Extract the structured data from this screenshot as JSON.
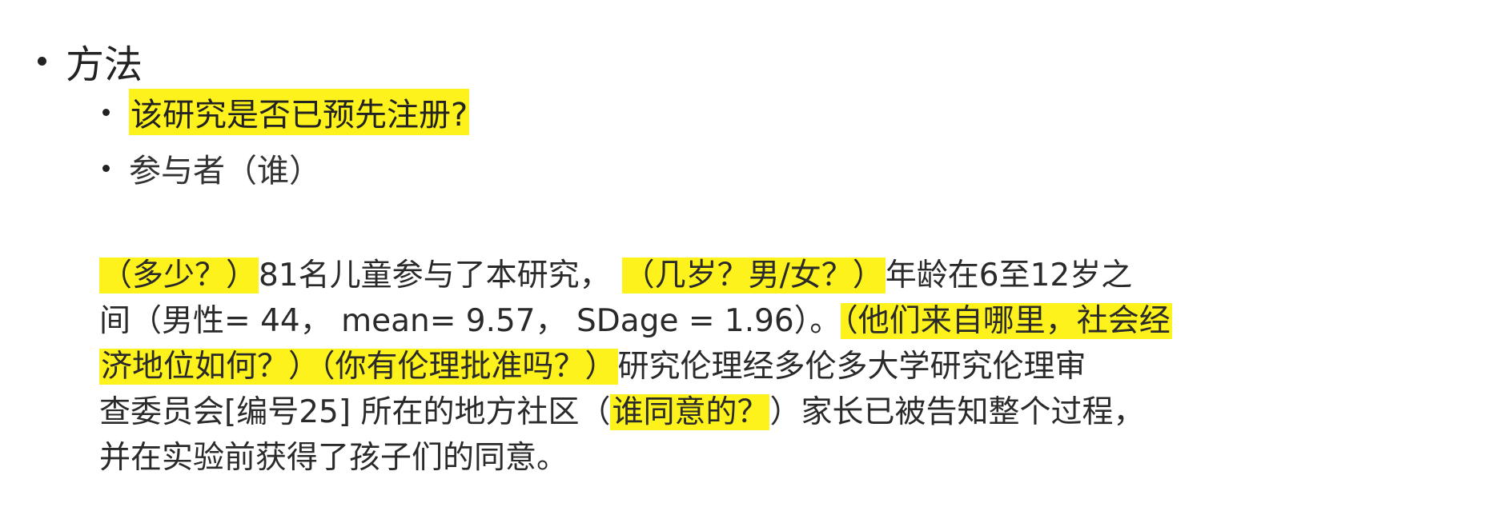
{
  "outline": {
    "level1": {
      "label": "方法"
    },
    "level2": [
      {
        "label": "该研究是否已预先注册?",
        "highlighted": true
      },
      {
        "label": "参与者（谁）",
        "highlighted": false
      }
    ]
  },
  "paragraph": {
    "lines": [
      [
        {
          "text": "（多少？）",
          "highlighted": true
        },
        {
          "text": "81名儿童参与了本研究，",
          "highlighted": false
        },
        {
          "text": "（几岁？男/女？）",
          "highlighted": true
        },
        {
          "text": "年龄在6至12岁之",
          "highlighted": false
        }
      ],
      [
        {
          "text": "间（男性= 44， mean= 9.57， SDage = 1.96）。",
          "highlighted": false
        },
        {
          "text": "（他们来自哪里，社会经",
          "highlighted": true
        }
      ],
      [
        {
          "text": "济地位如何？）（你有伦理批准吗？）",
          "highlighted": true
        },
        {
          "text": "研究伦理经多伦多大学研究伦理审",
          "highlighted": false
        }
      ],
      [
        {
          "text": "查委员会[编号25] 所在的地方社区（",
          "highlighted": false
        },
        {
          "text": "谁同意的？",
          "highlighted": true
        },
        {
          "text": "）家长已被告知整个过程，",
          "highlighted": false
        }
      ],
      [
        {
          "text": "并在实验前获得了孩子们的同意。",
          "highlighted": false
        }
      ]
    ]
  },
  "colors": {
    "highlight": "#fdf21c",
    "text": "#222222",
    "background": "#ffffff"
  }
}
